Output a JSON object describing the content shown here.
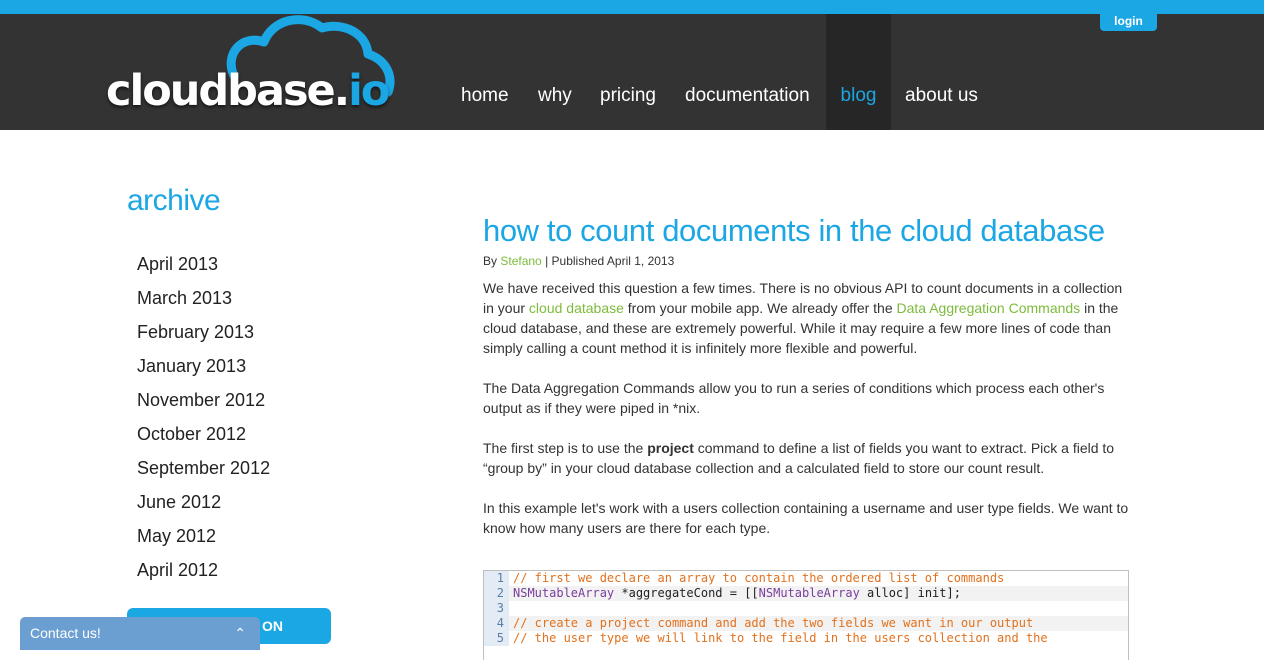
{
  "header": {
    "logo_text_main": "cloudbase.",
    "logo_text_io": "io",
    "login_label": "login",
    "nav": [
      {
        "label": "home"
      },
      {
        "label": "why"
      },
      {
        "label": "pricing"
      },
      {
        "label": "documentation"
      },
      {
        "label": "blog"
      },
      {
        "label": "about us"
      }
    ],
    "active_nav": "blog"
  },
  "sidebar": {
    "title": "archive",
    "items": [
      {
        "label": "April 2013"
      },
      {
        "label": "March 2013"
      },
      {
        "label": "February 2013"
      },
      {
        "label": "January 2013"
      },
      {
        "label": "November 2012"
      },
      {
        "label": "October 2012"
      },
      {
        "label": "September 2012"
      },
      {
        "label": "June 2012"
      },
      {
        "label": "May 2012"
      },
      {
        "label": "April 2012"
      }
    ],
    "button_label_visible": "ON",
    "contact_label": "Contact us!",
    "contact_icon": "chevron-up-icon"
  },
  "post": {
    "title": "how to count documents in the cloud database",
    "byline_prefix": "By",
    "author": "Stefano",
    "published": "| Published April 1, 2013",
    "p1_a": "We have received this question a few times. There is no obvious API to count documents in a collection in your ",
    "p1_link1": "cloud database",
    "p1_b": " from your mobile app. We already offer the ",
    "p1_link2": "Data Aggregation Commands",
    "p1_c": " in the cloud database, and these are extremely powerful. While it may require a few more lines of code than simply calling a count method it is infinitely more flexible and powerful.",
    "p2": "The Data Aggregation Commands allow you to run a series of conditions which process each other's output as if they were piped in *nix.",
    "p3_a": "The first step is to use the ",
    "p3_bold": "project",
    "p3_b": " command to define a list of fields you want to extract. Pick a field to “group by” in your cloud database collection and a calculated field to store our count result.",
    "p4": "In this example let's work with a users collection containing a username and user type fields. We want to know how many users are there for each type."
  },
  "code": {
    "lines": [
      {
        "n": "1",
        "text": "// first we declare an array to contain the ordered list of commands",
        "kind": "comment"
      },
      {
        "n": "2",
        "type": "NSMutableArray",
        "rest": " *aggregateCond = [[",
        "type2": "NSMutableArray",
        "rest2": " alloc] init];",
        "kind": "code"
      },
      {
        "n": "3",
        "text": "",
        "kind": "blank"
      },
      {
        "n": "4",
        "text": "// create a project command and add the two fields we want in our output",
        "kind": "comment"
      },
      {
        "n": "5",
        "text": "// the user type we will link to the field in the users collection and the",
        "kind": "comment"
      }
    ]
  },
  "colors": {
    "accent": "#1ba6e4",
    "header_bg": "#333333",
    "link_green": "#7dbb3c",
    "code_comment": "#e2711d"
  }
}
